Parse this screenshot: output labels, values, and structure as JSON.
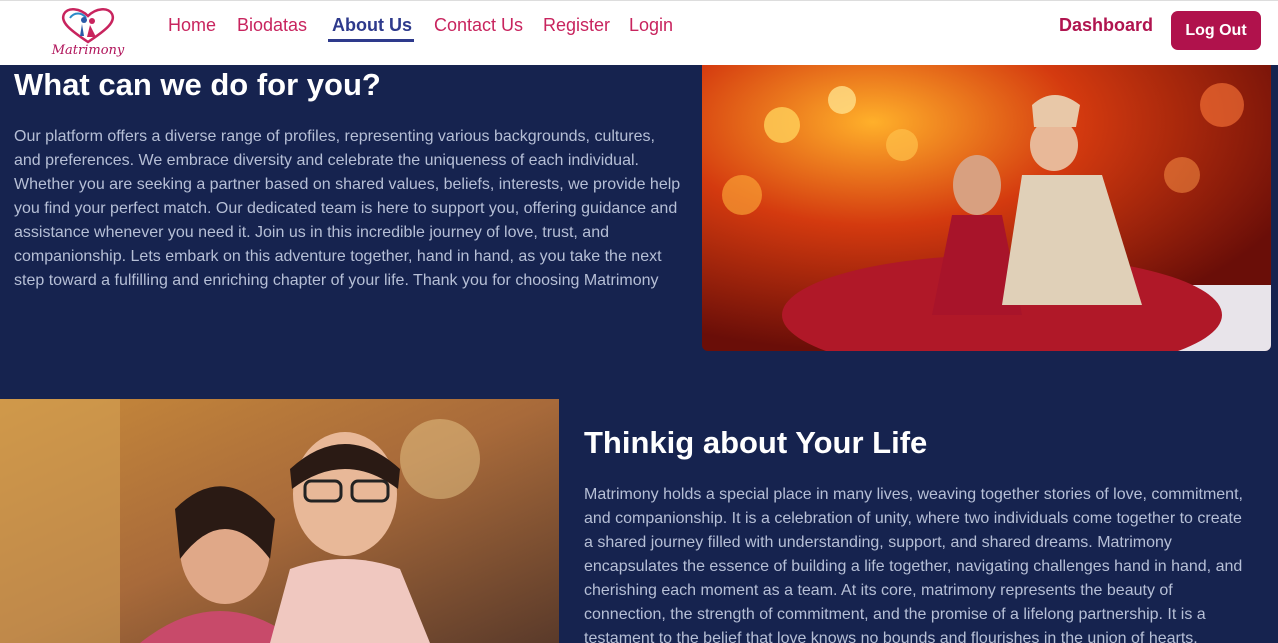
{
  "nav": {
    "logo_text": "Matrimony",
    "links": [
      "Home",
      "Biodatas",
      "About Us",
      "Contact Us",
      "Register",
      "Login"
    ],
    "active": "About Us",
    "dashboard": "Dashboard",
    "logout": "Log Out"
  },
  "section1": {
    "title": "What can we do for you?",
    "body": "Our platform offers a diverse range of profiles, representing various backgrounds, cultures, and preferences. We embrace diversity and celebrate the uniqueness of each individual. Whether you are seeking a partner based on shared values, beliefs, interests, we provide help you find your perfect match. Our dedicated team is here to support you, offering guidance and assistance whenever you need it. Join us in this incredible journey of love, trust, and companionship. Lets embark on this adventure together, hand in hand, as you take the next step toward a fulfilling and enriching chapter of your life. Thank you for choosing Matrimony"
  },
  "section2": {
    "title": "Thinkig about Your Life",
    "body": "Matrimony holds a special place in many lives, weaving together stories of love, commitment, and companionship. It is a celebration of unity, where two individuals come together to create a shared journey filled with understanding, support, and shared dreams. Matrimony encapsulates the essence of building a life together, navigating challenges hand in hand, and cherishing each moment as a team. At its core, matrimony represents the beauty of connection, the strength of commitment, and the promise of a lifelong partnership. It is a testament to the belief that love knows no bounds and flourishes in the union of hearts."
  }
}
